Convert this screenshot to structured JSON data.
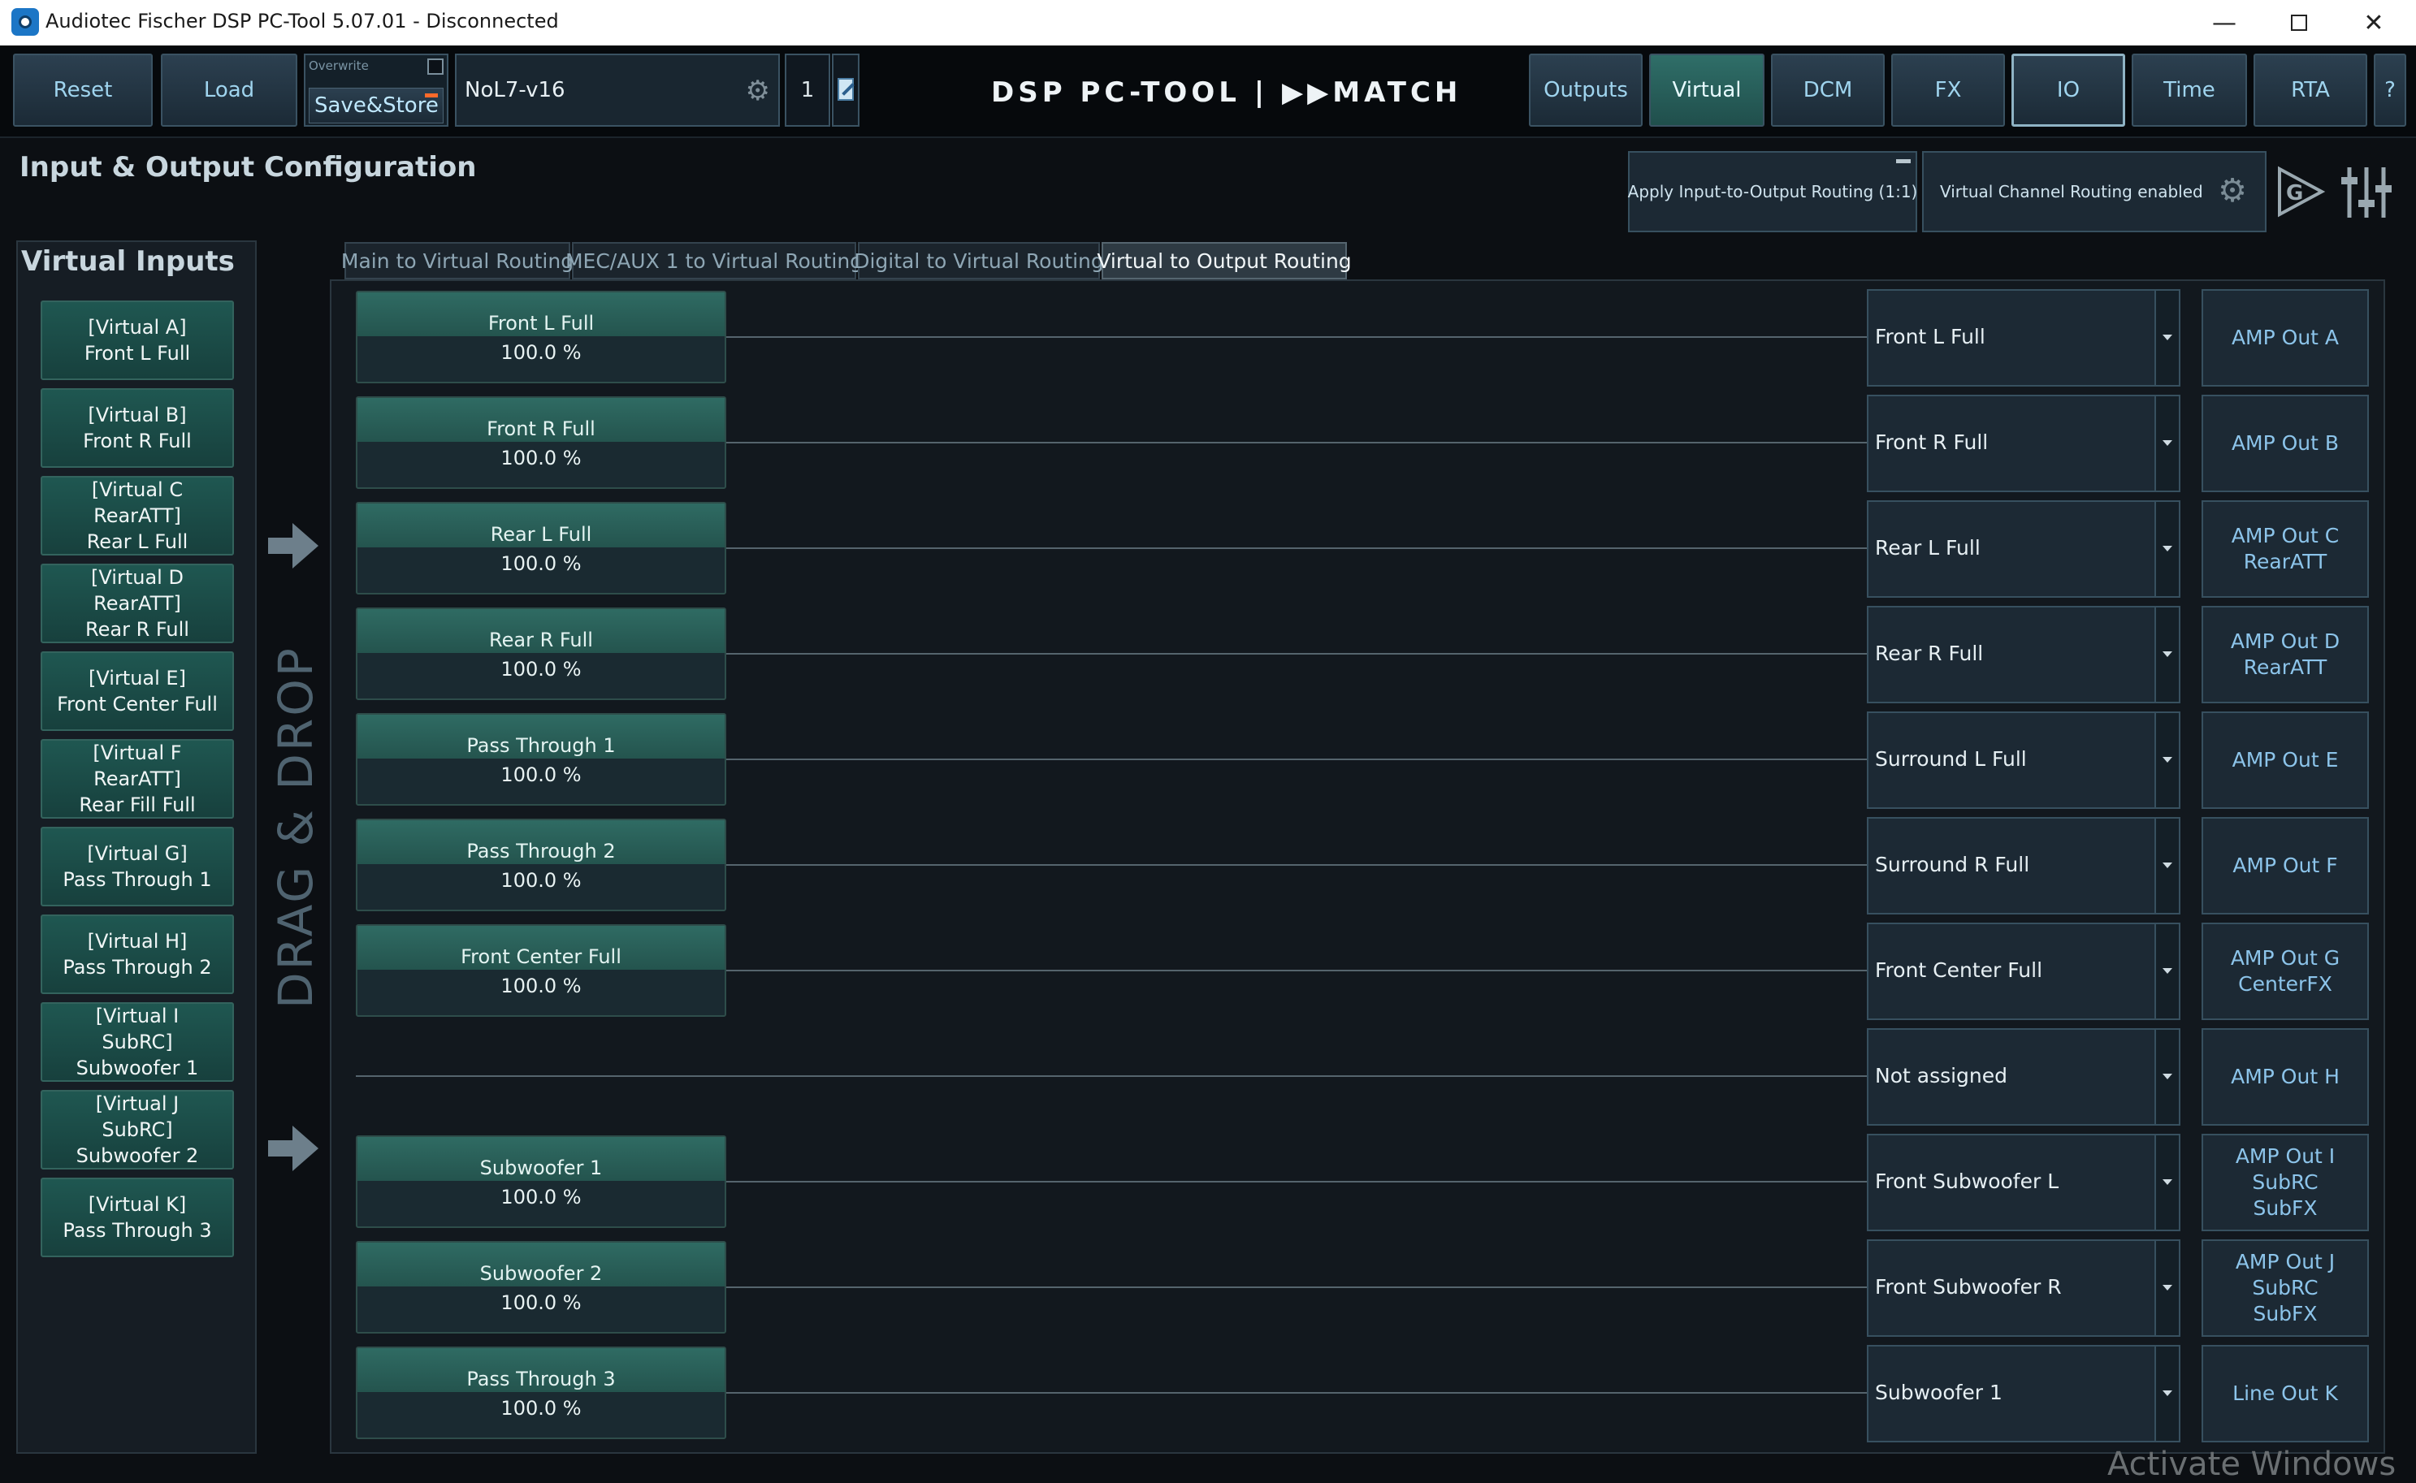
{
  "window": {
    "title": "Audiotec Fischer DSP PC-Tool 5.07.01 - Disconnected"
  },
  "toolbar": {
    "reset": "Reset",
    "load": "Load",
    "overwrite": "Overwrite",
    "save_store": "Save&Store",
    "preset_name": "NoL7-v16",
    "preset_number": "1",
    "logo": "DSP PC-TOOL | ▶▶MATCH",
    "nav": {
      "outputs": "Outputs",
      "virtual": "Virtual",
      "dcm": "DCM",
      "fx": "FX",
      "io": "IO",
      "time": "Time",
      "rta": "RTA",
      "help": "?"
    }
  },
  "page": {
    "title": "Input & Output Configuration",
    "apply_routing": "Apply Input-to-Output Routing (1:1)",
    "virtual_routing": "Virtual Channel Routing enabled"
  },
  "virtual_inputs": {
    "title": "Virtual Inputs",
    "items": [
      {
        "lines": [
          "[Virtual A]",
          "Front L Full"
        ]
      },
      {
        "lines": [
          "[Virtual B]",
          "Front R Full"
        ]
      },
      {
        "lines": [
          "[Virtual C",
          "RearATT]",
          "Rear L Full"
        ]
      },
      {
        "lines": [
          "[Virtual D",
          "RearATT]",
          "Rear R Full"
        ]
      },
      {
        "lines": [
          "[Virtual E]",
          "Front Center Full"
        ]
      },
      {
        "lines": [
          "[Virtual F",
          "RearATT]",
          "Rear Fill Full"
        ]
      },
      {
        "lines": [
          "[Virtual G]",
          "Pass Through 1"
        ]
      },
      {
        "lines": [
          "[Virtual H]",
          "Pass Through 2"
        ]
      },
      {
        "lines": [
          "[Virtual I",
          "SubRC]",
          "Subwoofer 1"
        ]
      },
      {
        "lines": [
          "[Virtual J",
          "SubRC]",
          "Subwoofer 2"
        ]
      },
      {
        "lines": [
          "[Virtual K]",
          "Pass Through 3"
        ]
      }
    ]
  },
  "drag_drop": "DRAG & DROP",
  "tabs": [
    "Main to Virtual Routing",
    "MEC/AUX 1 to Virtual Routing",
    "Digital to Virtual Routing",
    "Virtual to Output Routing"
  ],
  "active_tab": 3,
  "routes": [
    {
      "source": "Front L Full",
      "level": "100.0 %",
      "destination": "Front L Full",
      "output": [
        "AMP Out A"
      ]
    },
    {
      "source": "Front R Full",
      "level": "100.0 %",
      "destination": "Front R Full",
      "output": [
        "AMP Out B"
      ]
    },
    {
      "source": "Rear L Full",
      "level": "100.0 %",
      "destination": "Rear L Full",
      "output": [
        "AMP Out C",
        "RearATT"
      ]
    },
    {
      "source": "Rear R Full",
      "level": "100.0 %",
      "destination": "Rear R Full",
      "output": [
        "AMP Out D",
        "RearATT"
      ]
    },
    {
      "source": "Pass Through 1",
      "level": "100.0 %",
      "destination": "Surround L Full",
      "output": [
        "AMP Out E"
      ]
    },
    {
      "source": "Pass Through 2",
      "level": "100.0 %",
      "destination": "Surround R Full",
      "output": [
        "AMP Out F"
      ]
    },
    {
      "source": "Front Center Full",
      "level": "100.0 %",
      "destination": "Front Center Full",
      "output": [
        "AMP Out G",
        "CenterFX"
      ]
    },
    {
      "source": null,
      "level": null,
      "destination": "Not assigned",
      "output": [
        "AMP Out H"
      ]
    },
    {
      "source": "Subwoofer 1",
      "level": "100.0 %",
      "destination": "Front Subwoofer L",
      "output": [
        "AMP Out I",
        "SubRC",
        "SubFX"
      ]
    },
    {
      "source": "Subwoofer 2",
      "level": "100.0 %",
      "destination": "Front Subwoofer R",
      "output": [
        "AMP Out J",
        "SubRC",
        "SubFX"
      ]
    },
    {
      "source": "Pass Through 3",
      "level": "100.0 %",
      "destination": "Subwoofer 1",
      "output": [
        "Line Out K"
      ]
    }
  ],
  "icons": {
    "preset_gear": "gear-icon",
    "routing_gear": "gear-icon",
    "play_g": "play-g-icon",
    "sliders": "sliders-icon",
    "arrows": "arrow-right-icon"
  },
  "colors": {
    "accent_teal": "#2f6b63",
    "active_button": "#2f6e68",
    "output_text": "#8cc4ea",
    "save_indicator": "#ff6a2a"
  },
  "watermark": "Activate Windows"
}
